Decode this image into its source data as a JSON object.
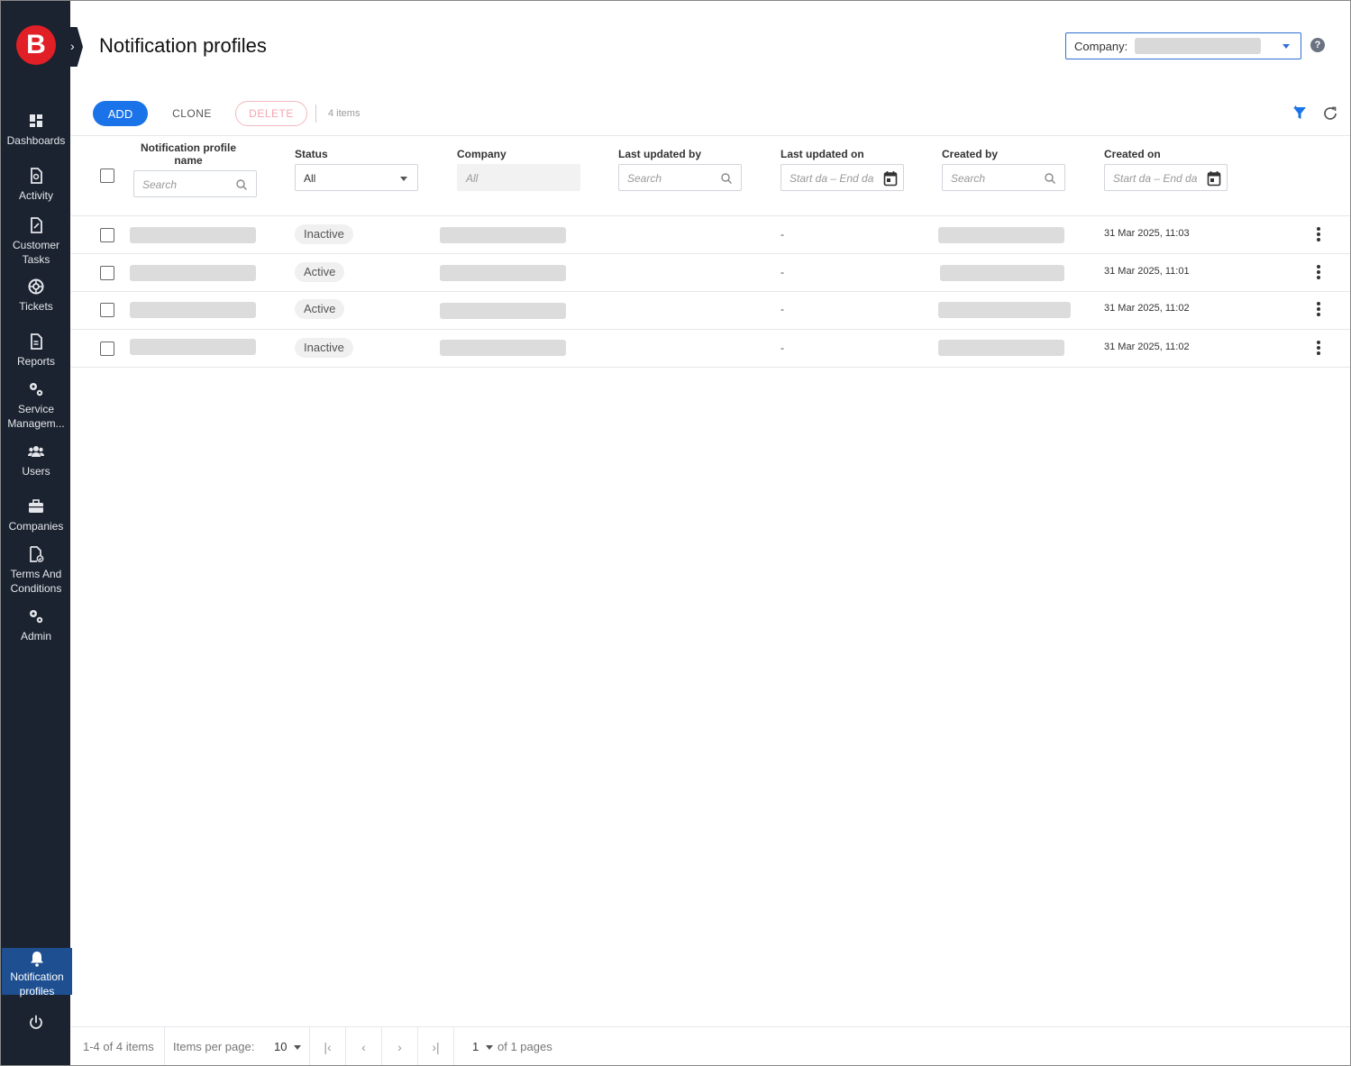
{
  "sidebar": {
    "logo": "B",
    "items": [
      {
        "label": "Dashboards",
        "icon": "dashboard-icon"
      },
      {
        "label": "Activity",
        "icon": "activity-icon"
      },
      {
        "label": "Customer Tasks",
        "icon": "customer-tasks-icon"
      },
      {
        "label": "Tickets",
        "icon": "tickets-icon"
      },
      {
        "label": "Reports",
        "icon": "reports-icon"
      },
      {
        "label": "Service Managem...",
        "icon": "service-management-icon"
      },
      {
        "label": "Users",
        "icon": "users-icon"
      },
      {
        "label": "Companies",
        "icon": "companies-icon"
      },
      {
        "label": "Terms And Conditions",
        "icon": "terms-icon"
      },
      {
        "label": "Admin",
        "icon": "admin-icon"
      }
    ],
    "active_item": {
      "label": "Notification profiles",
      "icon": "bell-icon"
    },
    "power_icon": "power-icon"
  },
  "header": {
    "title": "Notification profiles",
    "company_label": "Company:"
  },
  "toolbar": {
    "add_label": "ADD",
    "clone_label": "CLONE",
    "delete_label": "DELETE",
    "items_count": "4 items"
  },
  "columns": {
    "name": "Notification profile name",
    "status": "Status",
    "company": "Company",
    "last_updated_by": "Last updated by",
    "last_updated_on": "Last updated on",
    "created_by": "Created by",
    "created_on": "Created on"
  },
  "filters": {
    "name_placeholder": "Search",
    "status_value": "All",
    "company_value": "All",
    "last_updated_by_placeholder": "Search",
    "last_updated_on_placeholder": "Start da – End da",
    "created_by_placeholder": "Search",
    "created_on_placeholder": "Start da – End da"
  },
  "rows": [
    {
      "status": "Inactive",
      "last_updated_on": "-",
      "created_on": "31 Mar 2025, 11:03"
    },
    {
      "status": "Active",
      "last_updated_on": "-",
      "created_on": "31 Mar 2025, 11:01"
    },
    {
      "status": "Active",
      "last_updated_on": "-",
      "created_on": "31 Mar 2025, 11:02"
    },
    {
      "status": "Inactive",
      "last_updated_on": "-",
      "created_on": "31 Mar 2025, 11:02"
    }
  ],
  "footer": {
    "range": "1-4 of 4 items",
    "per_page_label": "Items per page:",
    "per_page_value": "10",
    "page_value": "1",
    "of_pages": "of 1 pages"
  },
  "colors": {
    "sidebar_bg": "#1b2330",
    "accent": "#1a73e8",
    "brand_red": "#e01f26",
    "active_nav": "#1d4f91"
  }
}
